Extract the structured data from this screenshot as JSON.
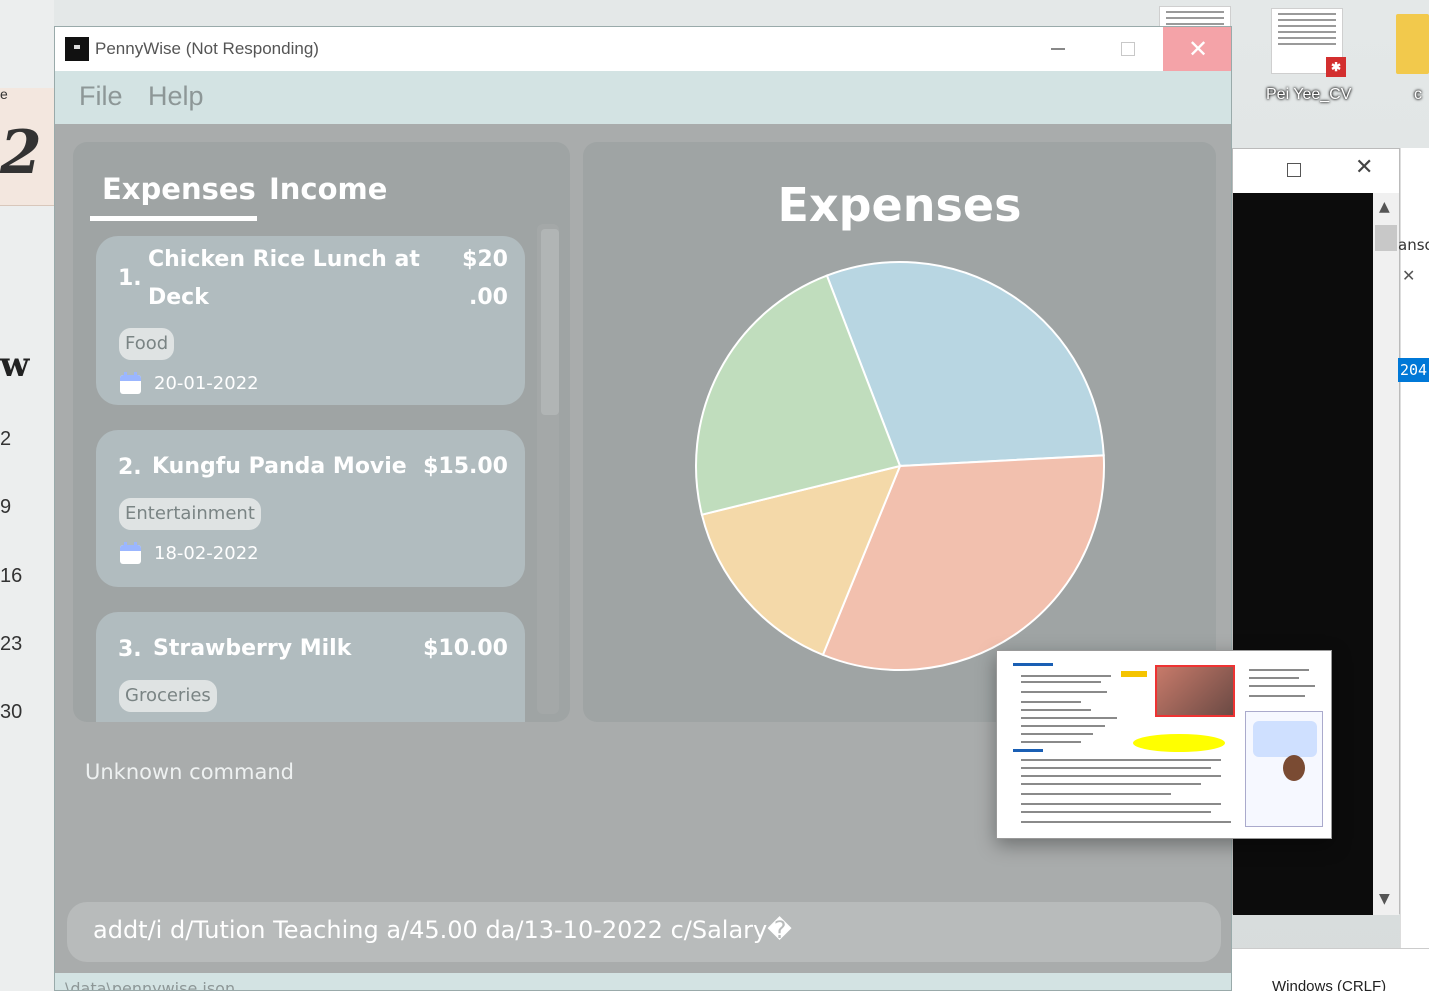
{
  "desktop": {
    "calendar_numbers": [
      "2",
      "9",
      "16",
      "23",
      "30"
    ],
    "calendar_glyph": "2",
    "calendar_w": "w",
    "edge_e": "e",
    "icons": [
      {
        "label": "Pei Yee_CV",
        "icon": "pdf-file-icon"
      },
      {
        "label": "c",
        "icon": "folder-icon"
      }
    ],
    "console_side_text": "anso",
    "console_side_value": "204",
    "taskbar_text": "Windows (CRLF)"
  },
  "window": {
    "title": "PennyWise (Not Responding)",
    "close_glyph": "✕"
  },
  "menu": {
    "file": "File",
    "help": "Help"
  },
  "tabs": {
    "expenses": "Expenses",
    "income": "Income",
    "active": "Expenses"
  },
  "entries": [
    {
      "index": "1.",
      "title_lines": [
        "Chicken Rice Lunch at",
        "Deck"
      ],
      "amount_lines": [
        "$20",
        ".00"
      ],
      "category": "Food",
      "date": "20-01-2022"
    },
    {
      "index": "2.",
      "title_lines": [
        "Kungfu Panda Movie"
      ],
      "amount_lines": [
        "$15.00"
      ],
      "category": "Entertainment",
      "date": "18-02-2022"
    },
    {
      "index": "3.",
      "title_lines": [
        "Strawberry Milk"
      ],
      "amount_lines": [
        "$10.00"
      ],
      "category": "Groceries",
      "date": ""
    }
  ],
  "chart_data": {
    "type": "pie",
    "title": "Expenses",
    "values": [
      30,
      32,
      15,
      23
    ],
    "colors": [
      "#b8d6e2",
      "#f2c0ae",
      "#f4d9a9",
      "#c0ddbd"
    ],
    "start_angle_deg": -111
  },
  "result": {
    "message": "Unknown command"
  },
  "command": {
    "input_value": "addt/i d/Tution Teaching a/45.00 da/13-10-2022 c/Salary�"
  },
  "status": {
    "text": "\\data\\pennywise.json"
  }
}
